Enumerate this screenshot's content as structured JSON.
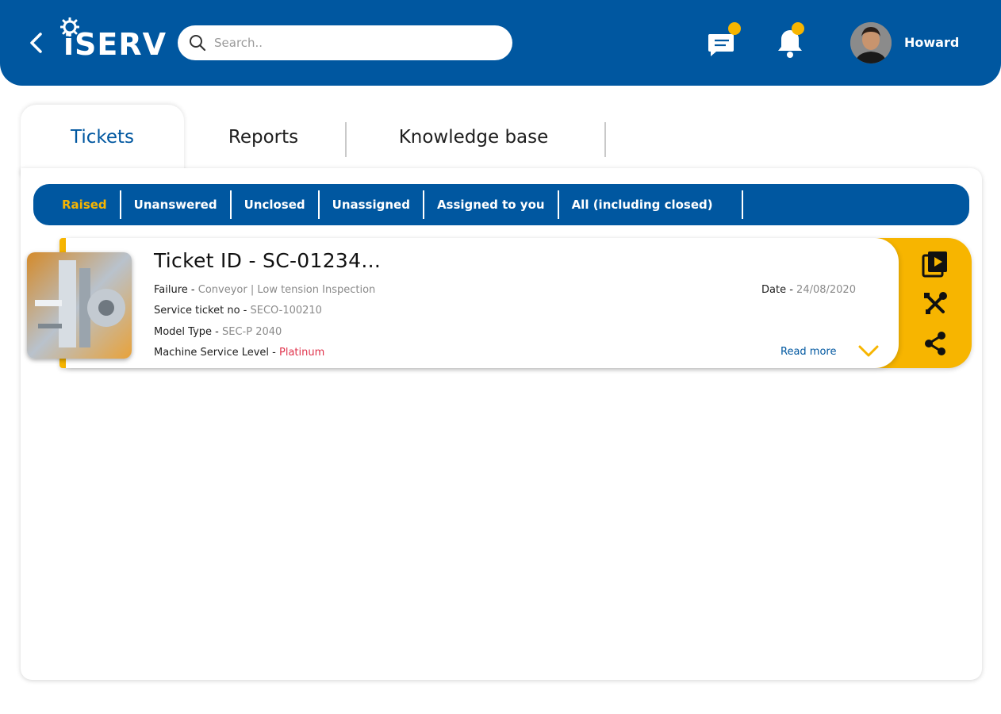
{
  "header": {
    "logo_text": "iSERV",
    "search_placeholder": "Search..",
    "username": "Howard",
    "brand_color": "#0057a0",
    "accent_color": "#f7b500"
  },
  "tabs": [
    {
      "label": "Tickets",
      "active": true
    },
    {
      "label": "Reports",
      "active": false
    },
    {
      "label": "Knowledge base",
      "active": false
    }
  ],
  "filters": [
    {
      "label": "Raised",
      "active": true
    },
    {
      "label": "Unanswered",
      "active": false
    },
    {
      "label": "Unclosed",
      "active": false
    },
    {
      "label": "Unassigned",
      "active": false
    },
    {
      "label": "Assigned to you",
      "active": false
    },
    {
      "label": "All (including closed)",
      "active": false
    }
  ],
  "ticket": {
    "title": "Ticket ID - SC-01234...",
    "failure_label": "Failure",
    "failure_value": "Conveyor | Low tension Inspection",
    "service_label": "Service ticket no",
    "service_value": "SECO-100210",
    "model_label": "Model Type",
    "model_value": "SEC-P 2040",
    "level_label": "Machine Service Level",
    "level_value": "Platinum",
    "date_label": "Date",
    "date_value": "24/08/2020",
    "read_more": "Read more",
    "actions": [
      "play-video-icon",
      "tools-icon",
      "share-icon"
    ]
  }
}
